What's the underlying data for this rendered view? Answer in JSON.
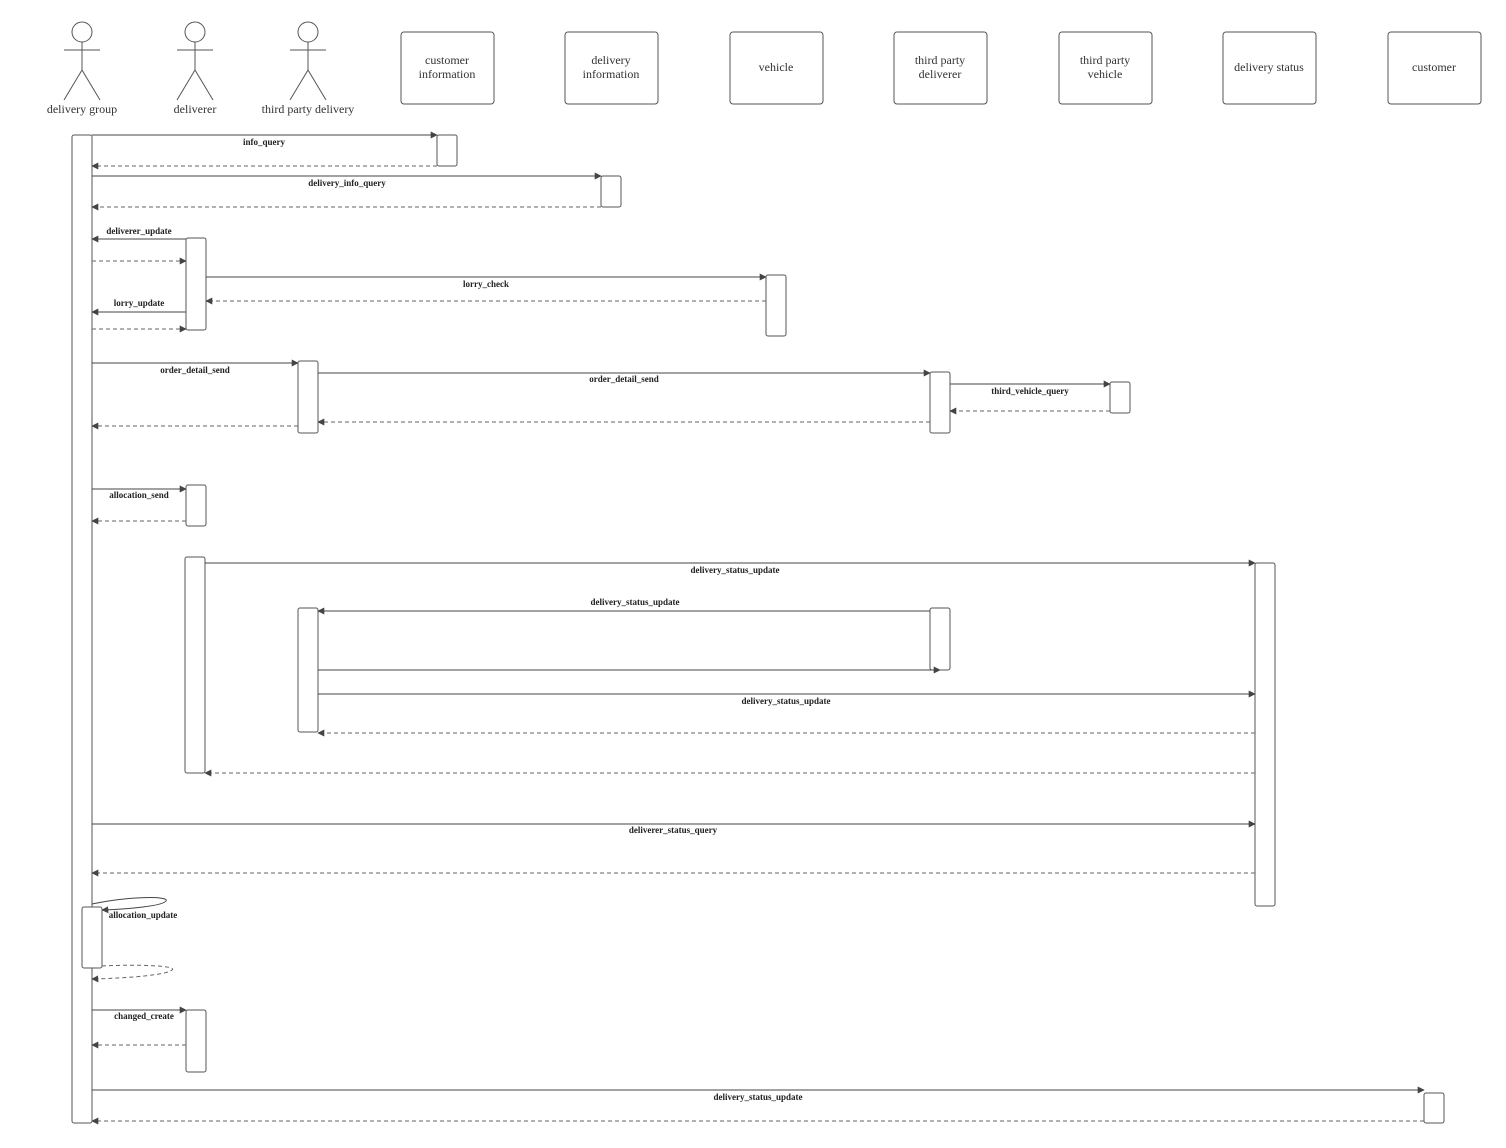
{
  "participants": [
    {
      "id": "delivery_group",
      "kind": "actor",
      "label": "delivery group"
    },
    {
      "id": "deliverer",
      "kind": "actor",
      "label": "deliverer"
    },
    {
      "id": "third_party_delivery",
      "kind": "actor",
      "label": "third party delivery"
    },
    {
      "id": "customer_information",
      "kind": "box",
      "label": [
        "customer",
        "information"
      ]
    },
    {
      "id": "delivery_information",
      "kind": "box",
      "label": [
        "delivery",
        "information"
      ]
    },
    {
      "id": "vehicle",
      "kind": "box",
      "label": [
        "vehicle"
      ]
    },
    {
      "id": "third_party_deliverer",
      "kind": "box",
      "label": [
        "third party",
        "deliverer"
      ]
    },
    {
      "id": "third_party_vehicle",
      "kind": "box",
      "label": [
        "third party",
        "vehicle"
      ]
    },
    {
      "id": "delivery_status",
      "kind": "box",
      "label": [
        "delivery status"
      ]
    },
    {
      "id": "customer",
      "kind": "box",
      "label": [
        "customer"
      ]
    }
  ],
  "messages": [
    {
      "label": "info_query"
    },
    {
      "label": "delivery_info_query"
    },
    {
      "label": "deliverer_update"
    },
    {
      "label": "lorry_check"
    },
    {
      "label": "lorry_update"
    },
    {
      "label": "order_detail_send"
    },
    {
      "label": "order_detail_send"
    },
    {
      "label": "third_vehicle_query"
    },
    {
      "label": "allocation_send"
    },
    {
      "label": "delivery_status_update"
    },
    {
      "label": "delivery_status_update"
    },
    {
      "label": "delivery_status_update"
    },
    {
      "label": "deliverer_status_query"
    },
    {
      "label": "allocation_update"
    },
    {
      "label": "changed_create"
    },
    {
      "label": "delivery_status_update"
    }
  ]
}
